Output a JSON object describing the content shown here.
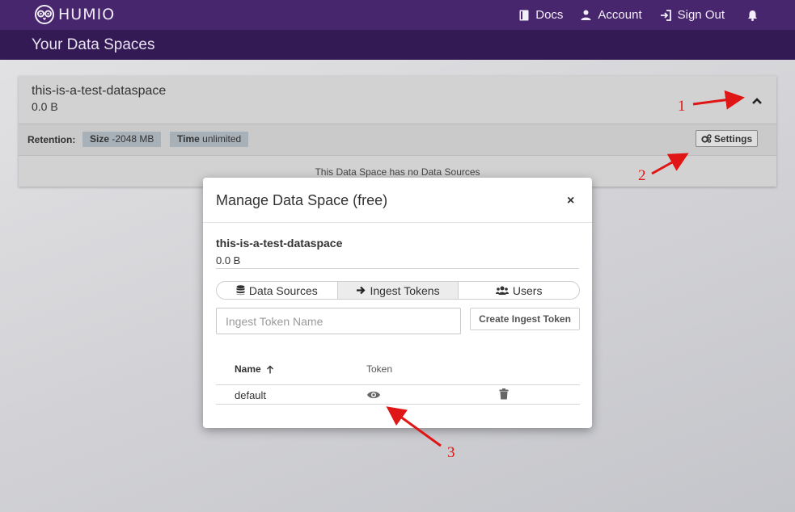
{
  "app": {
    "logo_text": "HUMIO"
  },
  "nav": {
    "docs": "Docs",
    "account": "Account",
    "sign_out": "Sign Out"
  },
  "page": {
    "title": "Your Data Spaces"
  },
  "dataspace": {
    "name": "this-is-a-test-dataspace",
    "size": "0.0 B",
    "retention_label": "Retention:",
    "size_badge_label": "Size",
    "size_badge_value": "-2048 MB",
    "time_badge_label": "Time",
    "time_badge_value": "unlimited",
    "settings_label": "Settings",
    "empty_text": "This Data Space has no Data Sources"
  },
  "modal": {
    "title": "Manage Data Space (free)",
    "close": "×",
    "ds_name": "this-is-a-test-dataspace",
    "ds_size": "0.0 B",
    "tabs": [
      {
        "label": "Data Sources",
        "icon": "database-icon"
      },
      {
        "label": "Ingest Tokens",
        "icon": "arrow-right-icon",
        "active": true
      },
      {
        "label": "Users",
        "icon": "users-icon"
      }
    ],
    "token_input_placeholder": "Ingest Token Name",
    "create_button": "Create Ingest Token",
    "table": {
      "col_name": "Name",
      "col_token": "Token",
      "rows": [
        {
          "name": "default"
        }
      ]
    }
  },
  "annotations": {
    "a1": "1",
    "a2": "2",
    "a3": "3"
  },
  "colors": {
    "topbar": "#48266d",
    "subbar": "#331a54",
    "annotation": "#e01515"
  }
}
